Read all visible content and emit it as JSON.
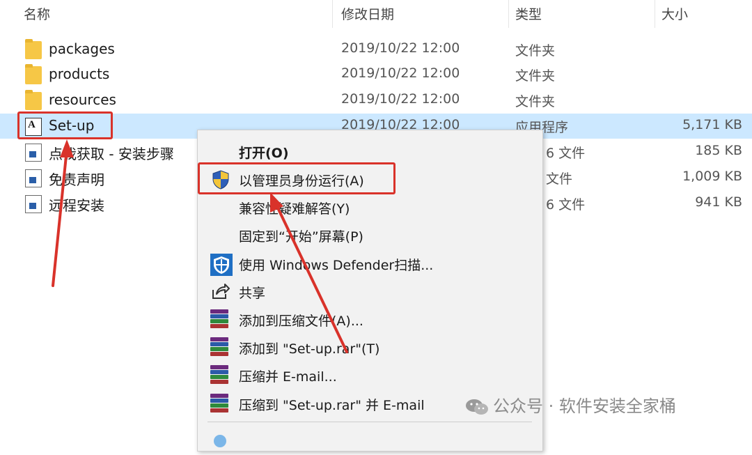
{
  "columns": {
    "name": "名称",
    "modified": "修改日期",
    "type": "类型",
    "size": "大小"
  },
  "files": [
    {
      "name": "packages",
      "date": "2019/10/22 12:00",
      "type": "文件夹",
      "size": "",
      "icon": "folder-icon"
    },
    {
      "name": "products",
      "date": "2019/10/22 12:00",
      "type": "文件夹",
      "size": "",
      "icon": "folder-icon"
    },
    {
      "name": "resources",
      "date": "2019/10/22 12:00",
      "type": "文件夹",
      "size": "",
      "icon": "folder-icon"
    },
    {
      "name": "Set-up",
      "date": "2019/10/22 12:00",
      "type": "应用程序",
      "size": "5,171 KB",
      "icon": "adobe-app-icon",
      "selected": true
    },
    {
      "name": "点我获取 - 安装步骤",
      "date": "",
      "type": "6 文件",
      "size": "185 KB",
      "icon": "document-icon"
    },
    {
      "name": "免责声明",
      "date": "",
      "type": "文件",
      "size": "1,009 KB",
      "icon": "document-icon"
    },
    {
      "name": "远程安装",
      "date": "",
      "type": "6 文件",
      "size": "941 KB",
      "icon": "document-icon"
    }
  ],
  "context_menu": {
    "items": [
      {
        "label": "打开(O)",
        "icon": "",
        "bold": true
      },
      {
        "label": "以管理员身份运行(A)",
        "icon": "uac-shield-icon",
        "highlighted": true
      },
      {
        "label": "兼容性疑难解答(Y)",
        "icon": ""
      },
      {
        "label": "固定到“开始”屏幕(P)",
        "icon": ""
      },
      {
        "label": "使用 Windows Defender扫描...",
        "icon": "defender-shield-icon"
      },
      {
        "label": "共享",
        "icon": "share-icon"
      },
      {
        "label": "添加到压缩文件(A)...",
        "icon": "winrar-icon"
      },
      {
        "label": "添加到 \"Set-up.rar\"(T)",
        "icon": "winrar-icon"
      },
      {
        "label": "压缩并 E-mail...",
        "icon": "winrar-icon"
      },
      {
        "label": "压缩到 \"Set-up.rar\" 并 E-mail",
        "icon": "winrar-icon"
      }
    ]
  },
  "watermark": "公众号 · 软件安装全家桶",
  "colors": {
    "selection": "#cce8ff",
    "highlight_box": "#d9322a",
    "folder": "#f6c746"
  }
}
